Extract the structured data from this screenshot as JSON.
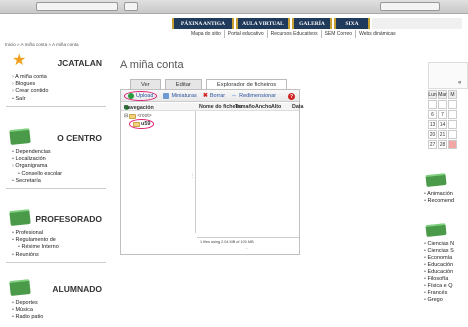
{
  "nav": {
    "items": [
      "PÁXINA ANTIGA",
      "AULA VIRTUAL",
      "GALERÍA",
      "SIXA"
    ]
  },
  "links": {
    "items": [
      "Mapa do sitio",
      "Portal educativo",
      "Recursos Educativos",
      "SEM Correo",
      "Webs dinámicas"
    ]
  },
  "breadcrumb": "Inicio » A miña conta » A miña conta",
  "sidebar": {
    "jcatalan": {
      "title": "JCATALAN",
      "items": [
        "A miña conta",
        "Blogues",
        "Crear contido",
        "Saír"
      ]
    },
    "centro": {
      "title": "O CENTRO",
      "items": [
        "Dependencias",
        "Localización",
        "Organigrama",
        "Consello escolar",
        "Secretaría"
      ]
    },
    "profesorado": {
      "title": "PROFESORADO",
      "items": [
        "Profesional",
        "Regulamento de",
        "Réxime Interno",
        "Reunións"
      ]
    },
    "alumnado": {
      "title": "ALUMNADO",
      "items": [
        "Deportes",
        "Música",
        "Radio patio"
      ]
    }
  },
  "main": {
    "title": "A miña conta",
    "tabs": [
      "Ver",
      "Editar",
      "Explorador de ficheiros"
    ],
    "toolbar": {
      "upload": "Upload",
      "miniaturas": "Miniaturas",
      "borrar": "Borrar",
      "redimensionar": "Redimensionar"
    },
    "columns": {
      "navegacion": "Navegación",
      "nome": "Nome do ficheiro",
      "tamano": "Tamaño",
      "ancho": "Ancho",
      "alto": "Alto",
      "data": "Data"
    },
    "tree": {
      "root": "<root>",
      "folder": "u59"
    },
    "status": "1 files using 2.04 MB of 100 MB",
    "resize_handle": "..."
  },
  "right": {
    "cal_nav": "«",
    "days": [
      "Lun",
      "Mar",
      "M"
    ],
    "weeks": [
      [
        "6",
        "7",
        ""
      ],
      [
        "13",
        "14",
        ""
      ],
      [
        "20",
        "21",
        ""
      ],
      [
        "27",
        "28",
        ""
      ]
    ],
    "list1": [
      "Animación",
      "Recomend"
    ],
    "list2": [
      "Ciencias N",
      "Ciencias S",
      "Economía",
      "Educación",
      "Educación",
      "Filosofía",
      "Física e Q",
      "Francés",
      "Grego"
    ]
  }
}
